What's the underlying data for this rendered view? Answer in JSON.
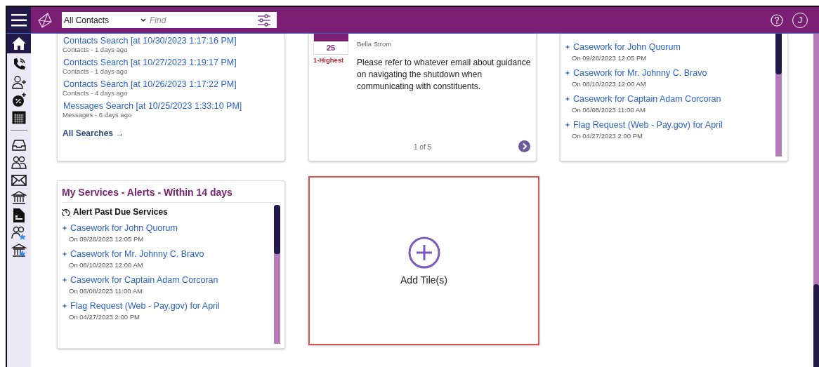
{
  "header": {
    "scope_select": "All Contacts",
    "search": {
      "placeholder": "Find"
    },
    "user_initial": "J"
  },
  "sidebar": {
    "items": [
      {
        "selected": true
      },
      {
        "selected": false
      },
      {
        "selected": false
      },
      {
        "selected": false
      },
      {
        "selected": false
      },
      {
        "selected": false
      },
      {
        "selected": false
      },
      {
        "selected": false
      },
      {
        "selected": false
      },
      {
        "selected": false
      },
      {
        "selected": false
      },
      {
        "selected": false
      }
    ]
  },
  "saved_searches": {
    "items": [
      {
        "title": "Contacts Search [at 10/30/2023 1:17:16 PM]",
        "meta": "Contacts - 1 days ago"
      },
      {
        "title": "Contacts Search [at 10/27/2023 1:19:17 PM]",
        "meta": "Contacts - 1 days ago"
      },
      {
        "title": "Contacts Search [at 10/26/2023 1:17:22 PM]",
        "meta": "Contacts - 4 days ago"
      },
      {
        "title": "Messages Search [at 10/25/2023 1:33:10 PM]",
        "meta": "Messages - 6 days ago"
      }
    ],
    "all_link": "All Searches →"
  },
  "announcement": {
    "day": "25",
    "priority": "1-Highest",
    "author": "Bella Strom",
    "body": "Please refer to whatever email about guidance on navigating the shutdown when communicating with constituents.",
    "pager": "1 of 5"
  },
  "alerts_top": {
    "items": [
      {
        "title": "Casework for John Quorum",
        "date": "On 09/28/2023 12:05 PM"
      },
      {
        "title": "Casework for Mr. Johnny C. Bravo",
        "date": "On 08/10/2023 12:00 AM"
      },
      {
        "title": "Casework for Captain Adam Corcoran",
        "date": "On 06/08/2023 11:00 AM"
      },
      {
        "title": "Flag Request (Web - Pay.gov) for April",
        "date": "On 04/27/2023 2:00 PM"
      }
    ]
  },
  "alerts_card": {
    "title": "My Services - Alerts - Within 14 days",
    "section": "Alert Past Due Services",
    "items": [
      {
        "title": "Casework for John Quorum",
        "date": "On 09/28/2023 12:05 PM"
      },
      {
        "title": "Casework for Mr. Johnny C. Bravo",
        "date": "On 08/10/2023 12:00 AM"
      },
      {
        "title": "Casework for Captain Adam Corcoran",
        "date": "On 06/08/2023 11:00 AM"
      },
      {
        "title": "Flag Request (Web - Pay.gov) for April",
        "date": "On 04/27/2023 2:00 PM"
      }
    ]
  },
  "add_tile": {
    "label": "Add Tile(s)"
  }
}
